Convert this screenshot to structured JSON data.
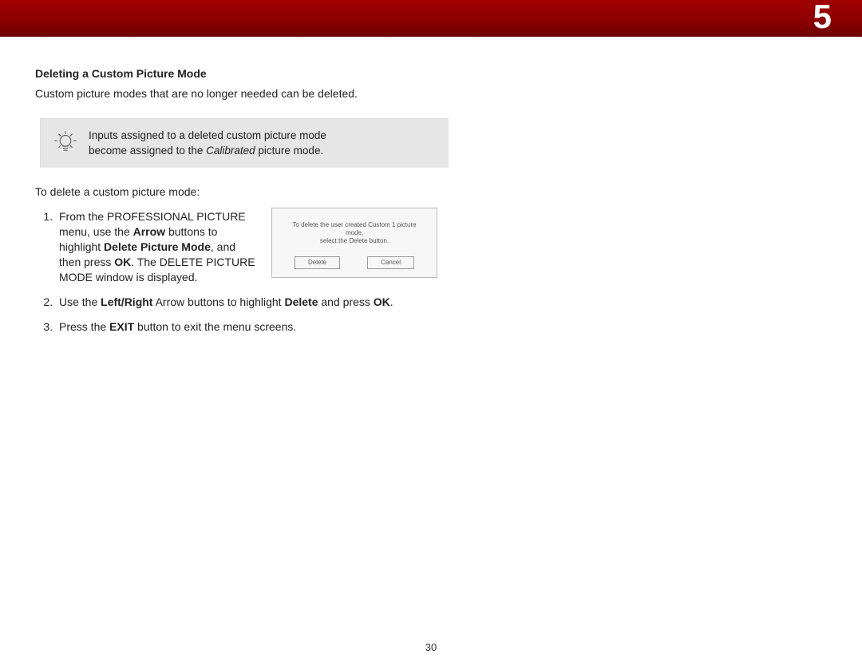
{
  "header": {
    "chapter": "5"
  },
  "section": {
    "title": "Deleting a Custom Picture Mode",
    "intro": "Custom picture modes that are no longer needed can be deleted."
  },
  "tip": {
    "line1": "Inputs assigned to a deleted custom picture mode",
    "line2a": "become assigned to the ",
    "line2b_italic": "Calibrated",
    "line2c": " picture mode."
  },
  "lead": "To delete a custom picture mode:",
  "step1": {
    "t1": "From the PROFESSIONAL PICTURE menu, use the ",
    "b1": "Arrow",
    "t2": " buttons to highlight ",
    "b2": "Delete Picture Mode",
    "t3": ", and then press ",
    "b3": "OK",
    "t4": ". The DELETE PICTURE MODE window is displayed."
  },
  "dialog": {
    "msg_l1": "To delete the user created Custom 1 picture mode,",
    "msg_l2": "select the Delete button.",
    "btn_delete": "Delete",
    "btn_cancel": "Cancel"
  },
  "step2": {
    "t1": "Use the ",
    "b1": "Left/Right",
    "t2": " Arrow buttons to highlight ",
    "b2": "Delete",
    "t3": " and press ",
    "b3": "OK",
    "t4": "."
  },
  "step3": {
    "t1": "Press the ",
    "b1": "EXIT",
    "t2": " button to exit the menu screens."
  },
  "page_number": "30"
}
